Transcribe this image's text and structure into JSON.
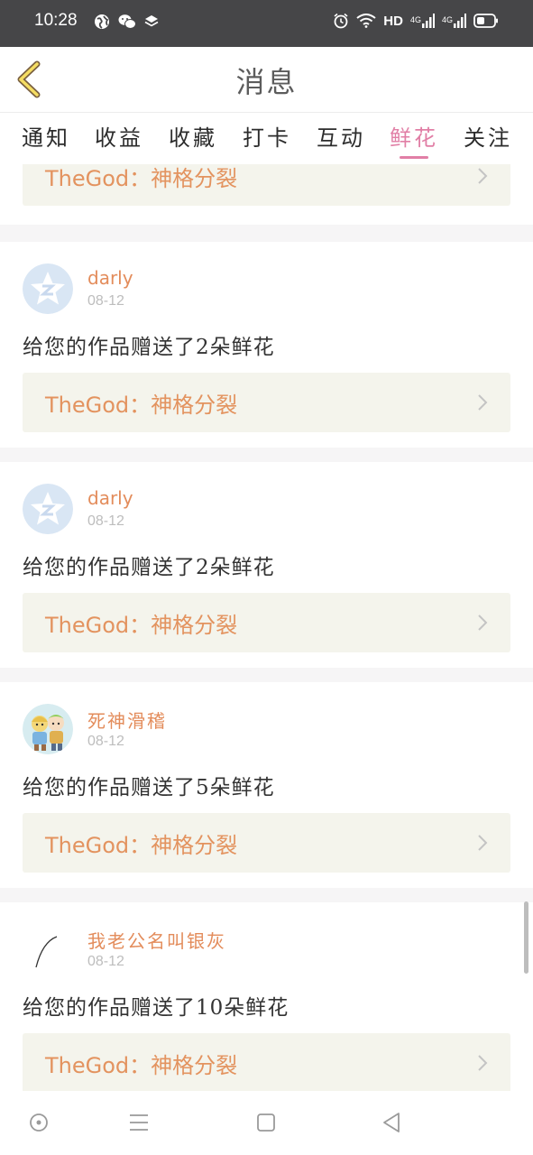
{
  "status_bar": {
    "time": "10:28",
    "network": "HD",
    "signal_type_1": "4G",
    "signal_type_2": "4G"
  },
  "header": {
    "title": "消息"
  },
  "tabs": [
    {
      "label": "通知",
      "active": false
    },
    {
      "label": "收益",
      "active": false
    },
    {
      "label": "收藏",
      "active": false
    },
    {
      "label": "打卡",
      "active": false
    },
    {
      "label": "互动",
      "active": false
    },
    {
      "label": "鲜花",
      "active": true
    },
    {
      "label": "关注",
      "active": false
    }
  ],
  "items": [
    {
      "work": "TheGod：神格分裂"
    },
    {
      "sender": "darly",
      "date": "08-12",
      "message": "给您的作品赠送了2朵鲜花",
      "work": "TheGod：神格分裂",
      "avatar": "default-qq-avatar"
    },
    {
      "sender": "darly",
      "date": "08-12",
      "message": "给您的作品赠送了2朵鲜花",
      "work": "TheGod：神格分裂",
      "avatar": "default-qq-avatar"
    },
    {
      "sender": "死神滑稽",
      "date": "08-12",
      "message": "给您的作品赠送了5朵鲜花",
      "work": "TheGod：神格分裂",
      "avatar": "cartoon-character-avatar"
    },
    {
      "sender": "我老公名叫银灰",
      "date": "08-12",
      "message": "给您的作品赠送了10朵鲜花",
      "work": "TheGod：神格分裂",
      "avatar": "sketch-avatar"
    }
  ],
  "colors": {
    "accent": "#e17fa6",
    "sender": "#e38c5b",
    "work_link_bg": "#f4f4ec",
    "status_bar": "#464648"
  }
}
